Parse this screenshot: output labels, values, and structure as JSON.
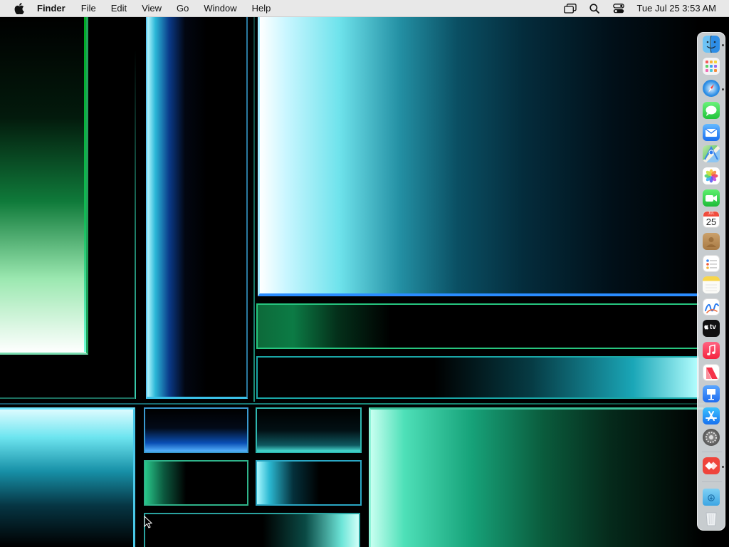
{
  "menubar": {
    "apple_icon": "apple-logo-icon",
    "app_name": "Finder",
    "menus": [
      "File",
      "Edit",
      "View",
      "Go",
      "Window",
      "Help"
    ],
    "status_icons": [
      "screen-mirroring-icon",
      "spotlight-search-icon",
      "control-center-icon"
    ],
    "clock": "Tue Jul 25  3:53 AM"
  },
  "dock": {
    "apps": [
      {
        "name": "Finder",
        "icon": "finder-icon",
        "running": true
      },
      {
        "name": "Launchpad",
        "icon": "launchpad-icon",
        "running": false
      },
      {
        "name": "Safari",
        "icon": "safari-icon",
        "running": true
      },
      {
        "name": "Messages",
        "icon": "messages-icon",
        "running": false
      },
      {
        "name": "Mail",
        "icon": "mail-icon",
        "running": false
      },
      {
        "name": "Maps",
        "icon": "maps-icon",
        "running": false
      },
      {
        "name": "Photos",
        "icon": "photos-icon",
        "running": false
      },
      {
        "name": "FaceTime",
        "icon": "facetime-icon",
        "running": false
      },
      {
        "name": "Calendar",
        "icon": "calendar-icon",
        "running": false
      },
      {
        "name": "Contacts",
        "icon": "contacts-icon",
        "running": false
      },
      {
        "name": "Reminders",
        "icon": "reminders-icon",
        "running": false
      },
      {
        "name": "Notes",
        "icon": "notes-icon",
        "running": false
      },
      {
        "name": "Freeform",
        "icon": "freeform-icon",
        "running": false
      },
      {
        "name": "TV",
        "icon": "apple-tv-icon",
        "running": false
      },
      {
        "name": "Music",
        "icon": "music-icon",
        "running": false
      },
      {
        "name": "News",
        "icon": "news-icon",
        "running": false
      },
      {
        "name": "Keynote",
        "icon": "keynote-icon",
        "running": false
      },
      {
        "name": "App Store",
        "icon": "app-store-icon",
        "running": false
      },
      {
        "name": "System Settings",
        "icon": "system-settings-icon",
        "running": false
      }
    ],
    "extra_apps": [
      {
        "name": "AnyDesk",
        "icon": "anydesk-icon",
        "running": true
      }
    ],
    "calendar": {
      "month": "JUL",
      "day": "25"
    },
    "tv_label": "tv",
    "folders": [
      {
        "name": "Downloads",
        "icon": "downloads-folder-icon"
      },
      {
        "name": "Trash",
        "icon": "trash-icon"
      }
    ]
  },
  "colors": {
    "menubar_bg": "#e8e8e8",
    "dock_bg": "#e2e8ec",
    "wallpaper_accent_cyan": "#6fe3ec",
    "wallpaper_accent_green": "#17a37a"
  },
  "cursor": "arrow-pointer-icon"
}
